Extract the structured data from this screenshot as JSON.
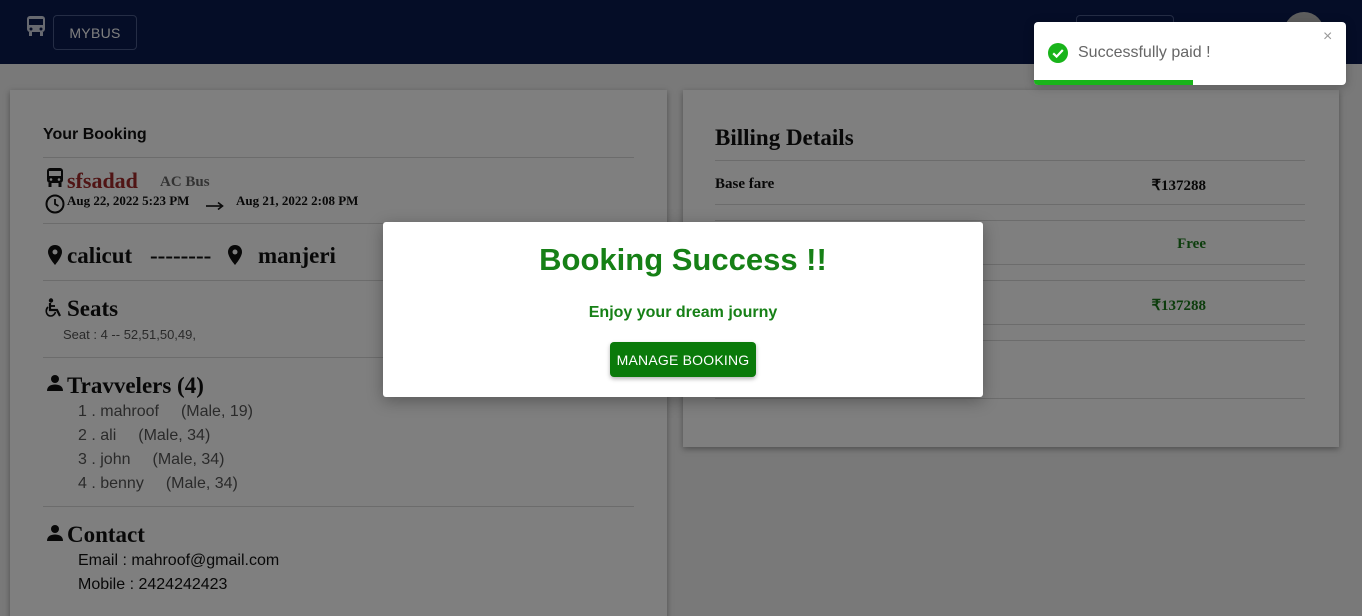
{
  "nav": {
    "brand": "MYBUS"
  },
  "booking": {
    "heading": "Your Booking",
    "bus_name": "sfsadad",
    "bus_type": "AC Bus",
    "departure": "Aug 22, 2022 5:23 PM",
    "arrival": "Aug 21, 2022 2:08 PM",
    "from": "calicut",
    "separator": "--------",
    "to": "manjeri",
    "seats_heading": "Seats",
    "seat_info": "Seat : 4 -- 52,51,50,49,",
    "travelers_heading": "Travvelers (4)",
    "travelers": [
      {
        "label": "1 . mahroof",
        "info": "(Male, 19)"
      },
      {
        "label": "2 . ali",
        "info": "(Male, 34)"
      },
      {
        "label": "3 . john",
        "info": "(Male, 34)"
      },
      {
        "label": "4 . benny",
        "info": "(Male, 34)"
      }
    ],
    "contact_heading": "Contact",
    "email": "Email : mahroof@gmail.com",
    "mobile": "Mobile : 2424242423"
  },
  "billing": {
    "heading": "Billing Details",
    "base_fare_label": "Base fare",
    "base_fare_value": "₹137288",
    "row2_value": "Free",
    "row3_value": "₹137288"
  },
  "modal": {
    "title": "Booking Success !!",
    "subtitle": "Enjoy your dream journy",
    "button": "MANAGE BOOKING"
  },
  "toast": {
    "message": "Successfully paid !",
    "close": "×",
    "progress": 0.51
  },
  "colors": {
    "navbar": "#0a1a4e",
    "success_green": "#168016",
    "bus_name": "#a02a2a",
    "toast_progress": "#19b41a"
  }
}
